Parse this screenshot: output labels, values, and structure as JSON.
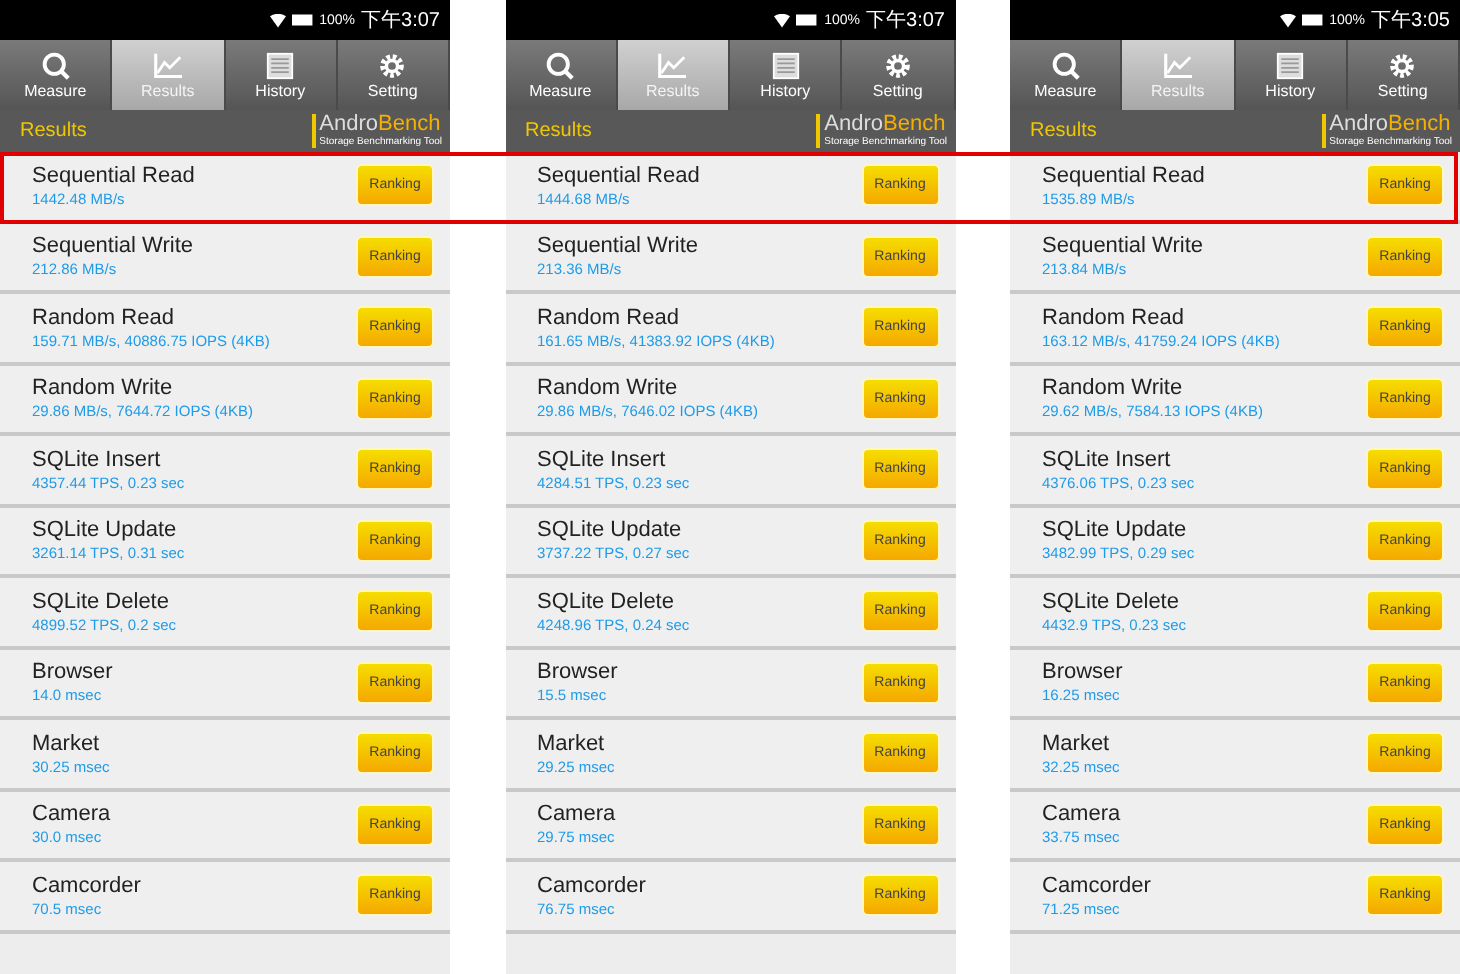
{
  "highlight_first_row": true,
  "screens": [
    {
      "status_bar": {
        "battery": "100%",
        "time": "下午3:07"
      },
      "tabs": [
        {
          "label": "Measure",
          "selected": false
        },
        {
          "label": "Results",
          "selected": true
        },
        {
          "label": "History",
          "selected": false
        },
        {
          "label": "Setting",
          "selected": false
        }
      ],
      "header_title": "Results",
      "logo": {
        "wordmark": [
          "Andro",
          "Bench"
        ],
        "tagline": "Storage Benchmarking Tool"
      },
      "results": [
        {
          "name": "Sequential Read",
          "value": "1442.48 MB/s",
          "button": "Ranking"
        },
        {
          "name": "Sequential Write",
          "value": "212.86 MB/s",
          "button": "Ranking"
        },
        {
          "name": "Random Read",
          "value": "159.71 MB/s, 40886.75 IOPS (4KB)",
          "button": "Ranking"
        },
        {
          "name": "Random Write",
          "value": "29.86 MB/s, 7644.72 IOPS (4KB)",
          "button": "Ranking"
        },
        {
          "name": "SQLite Insert",
          "value": "4357.44 TPS, 0.23 sec",
          "button": "Ranking"
        },
        {
          "name": "SQLite Update",
          "value": "3261.14 TPS, 0.31 sec",
          "button": "Ranking"
        },
        {
          "name": "SQLite Delete",
          "value": "4899.52 TPS, 0.2 sec",
          "button": "Ranking"
        },
        {
          "name": "Browser",
          "value": "14.0 msec",
          "button": "Ranking"
        },
        {
          "name": "Market",
          "value": "30.25 msec",
          "button": "Ranking"
        },
        {
          "name": "Camera",
          "value": "30.0 msec",
          "button": "Ranking"
        },
        {
          "name": "Camcorder",
          "value": "70.5 msec",
          "button": "Ranking"
        }
      ]
    },
    {
      "status_bar": {
        "battery": "100%",
        "time": "下午3:07"
      },
      "tabs": [
        {
          "label": "Measure",
          "selected": false
        },
        {
          "label": "Results",
          "selected": true
        },
        {
          "label": "History",
          "selected": false
        },
        {
          "label": "Setting",
          "selected": false
        }
      ],
      "header_title": "Results",
      "logo": {
        "wordmark": [
          "Andro",
          "Bench"
        ],
        "tagline": "Storage Benchmarking Tool"
      },
      "results": [
        {
          "name": "Sequential Read",
          "value": "1444.68 MB/s",
          "button": "Ranking"
        },
        {
          "name": "Sequential Write",
          "value": "213.36 MB/s",
          "button": "Ranking"
        },
        {
          "name": "Random Read",
          "value": "161.65 MB/s, 41383.92 IOPS (4KB)",
          "button": "Ranking"
        },
        {
          "name": "Random Write",
          "value": "29.86 MB/s, 7646.02 IOPS (4KB)",
          "button": "Ranking"
        },
        {
          "name": "SQLite Insert",
          "value": "4284.51 TPS, 0.23 sec",
          "button": "Ranking"
        },
        {
          "name": "SQLite Update",
          "value": "3737.22 TPS, 0.27 sec",
          "button": "Ranking"
        },
        {
          "name": "SQLite Delete",
          "value": "4248.96 TPS, 0.24 sec",
          "button": "Ranking"
        },
        {
          "name": "Browser",
          "value": "15.5 msec",
          "button": "Ranking"
        },
        {
          "name": "Market",
          "value": "29.25 msec",
          "button": "Ranking"
        },
        {
          "name": "Camera",
          "value": "29.75 msec",
          "button": "Ranking"
        },
        {
          "name": "Camcorder",
          "value": "76.75 msec",
          "button": "Ranking"
        }
      ]
    },
    {
      "status_bar": {
        "battery": "100%",
        "time": "下午3:05"
      },
      "tabs": [
        {
          "label": "Measure",
          "selected": false
        },
        {
          "label": "Results",
          "selected": true
        },
        {
          "label": "History",
          "selected": false
        },
        {
          "label": "Setting",
          "selected": false
        }
      ],
      "header_title": "Results",
      "logo": {
        "wordmark": [
          "Andro",
          "Bench"
        ],
        "tagline": "Storage Benchmarking Tool"
      },
      "results": [
        {
          "name": "Sequential Read",
          "value": "1535.89 MB/s",
          "button": "Ranking"
        },
        {
          "name": "Sequential Write",
          "value": "213.84 MB/s",
          "button": "Ranking"
        },
        {
          "name": "Random Read",
          "value": "163.12 MB/s, 41759.24 IOPS (4KB)",
          "button": "Ranking"
        },
        {
          "name": "Random Write",
          "value": "29.62 MB/s, 7584.13 IOPS (4KB)",
          "button": "Ranking"
        },
        {
          "name": "SQLite Insert",
          "value": "4376.06 TPS, 0.23 sec",
          "button": "Ranking"
        },
        {
          "name": "SQLite Update",
          "value": "3482.99 TPS, 0.29 sec",
          "button": "Ranking"
        },
        {
          "name": "SQLite Delete",
          "value": "4432.9 TPS, 0.23 sec",
          "button": "Ranking"
        },
        {
          "name": "Browser",
          "value": "16.25 msec",
          "button": "Ranking"
        },
        {
          "name": "Market",
          "value": "32.25 msec",
          "button": "Ranking"
        },
        {
          "name": "Camera",
          "value": "33.75 msec",
          "button": "Ranking"
        },
        {
          "name": "Camcorder",
          "value": "71.25 msec",
          "button": "Ranking"
        }
      ]
    }
  ]
}
